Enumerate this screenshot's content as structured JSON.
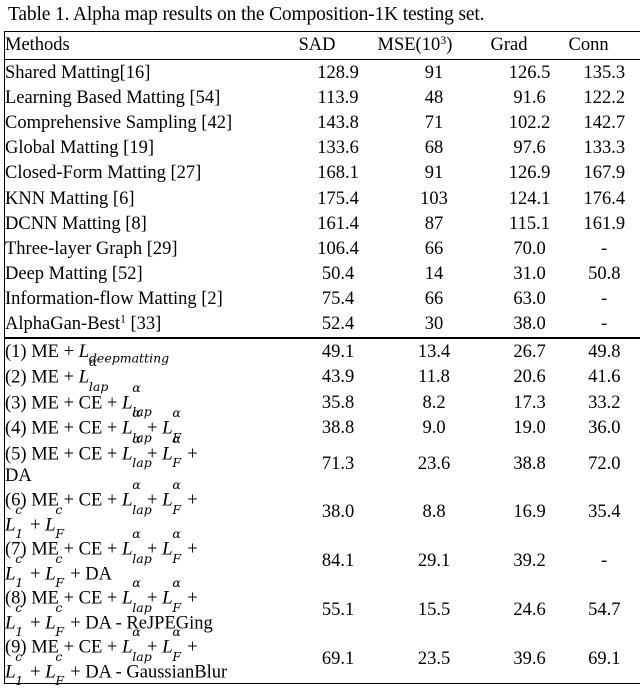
{
  "caption": "Table 1. Alpha map results on the Composition-1K testing set.",
  "table": {
    "columns": [
      "Methods",
      "SAD",
      "MSE(10³)",
      "Grad",
      "Conn"
    ],
    "headers": {
      "methods": "Methods",
      "sad": "SAD",
      "mse": "MSE(10",
      "mse_exp": "3",
      "mse_close": ")",
      "grad": "Grad",
      "conn": "Conn"
    },
    "prior_work": [
      {
        "method": "Shared Matting[16]",
        "sad": "128.9",
        "mse": "91",
        "grad": "126.5",
        "conn": "135.3"
      },
      {
        "method": "Learning Based Matting [54]",
        "sad": "113.9",
        "mse": "48",
        "grad": "91.6",
        "conn": "122.2"
      },
      {
        "method": "Comprehensive Sampling [42]",
        "sad": "143.8",
        "mse": "71",
        "grad": "102.2",
        "conn": "142.7"
      },
      {
        "method": "Global Matting [19]",
        "sad": "133.6",
        "mse": "68",
        "grad": "97.6",
        "conn": "133.3"
      },
      {
        "method": "Closed-Form Matting [27]",
        "sad": "168.1",
        "mse": "91",
        "grad": "126.9",
        "conn": "167.9"
      },
      {
        "method": "KNN Matting [6]",
        "sad": "175.4",
        "mse": "103",
        "grad": "124.1",
        "conn": "176.4"
      },
      {
        "method": "DCNN Matting [8]",
        "sad": "161.4",
        "mse": "87",
        "grad": "115.1",
        "conn": "161.9"
      },
      {
        "method": "Three-layer Graph [29]",
        "sad": "106.4",
        "mse": "66",
        "grad": "70.0",
        "conn": "-"
      },
      {
        "method": "Deep Matting [52]",
        "sad": "50.4",
        "mse": "14",
        "grad": "31.0",
        "conn": "50.8"
      },
      {
        "method": "Information-flow Matting [2]",
        "sad": "75.4",
        "mse": "66",
        "grad": "63.0",
        "conn": "-"
      },
      {
        "method": "AlphaGan-Best",
        "method_footnote": "1",
        "method_tail": " [33]",
        "sad": "52.4",
        "mse": "30",
        "grad": "38.0",
        "conn": "-"
      }
    ],
    "ablations": [
      {
        "index": "(1)",
        "sad": "49.1",
        "mse": "13.4",
        "grad": "26.7",
        "conn": "49.8",
        "sad_bold": false,
        "mse_bold": false,
        "grad_bold": false,
        "conn_bold": false
      },
      {
        "index": "(2)",
        "sad": "43.9",
        "mse": "11.8",
        "grad": "20.6",
        "conn": "41.6",
        "sad_bold": false,
        "mse_bold": false,
        "grad_bold": false,
        "conn_bold": false
      },
      {
        "index": "(3)",
        "sad": "35.8",
        "mse": "8.2",
        "grad": "17.3",
        "conn": "33.2",
        "sad_bold": true,
        "mse_bold": true,
        "grad_bold": false,
        "conn_bold": true
      },
      {
        "index": "(4)",
        "sad": "38.8",
        "mse": "9.0",
        "grad": "19.0",
        "conn": "36.0",
        "sad_bold": false,
        "mse_bold": false,
        "grad_bold": false,
        "conn_bold": false
      },
      {
        "index": "(5)",
        "sad": "71.3",
        "mse": "23.6",
        "grad": "38.8",
        "conn": "72.0",
        "sad_bold": false,
        "mse_bold": false,
        "grad_bold": false,
        "conn_bold": false
      },
      {
        "index": "(6)",
        "sad": "38.0",
        "mse": "8.8",
        "grad": "16.9",
        "conn": "35.4",
        "sad_bold": false,
        "mse_bold": false,
        "grad_bold": true,
        "conn_bold": false
      },
      {
        "index": "(7)",
        "sad": "84.1",
        "mse": "29.1",
        "grad": "39.2",
        "conn": "-",
        "sad_bold": false,
        "mse_bold": false,
        "grad_bold": false,
        "conn_bold": false
      },
      {
        "index": "(8)",
        "sad": "55.1",
        "mse": "15.5",
        "grad": "24.6",
        "conn": "54.7",
        "sad_bold": false,
        "mse_bold": false,
        "grad_bold": false,
        "conn_bold": false
      },
      {
        "index": "(9)",
        "sad": "69.1",
        "mse": "23.5",
        "grad": "39.6",
        "conn": "69.1",
        "sad_bold": false,
        "mse_bold": false,
        "grad_bold": false,
        "conn_bold": false
      }
    ],
    "ablation_terms": {
      "me": "ME",
      "ce": "CE",
      "da": "DA",
      "plus": "+",
      "minus": "-",
      "rejpeging": "ReJPEGing",
      "gaussianblur": "GaussianBlur",
      "loss_symbol": "L",
      "sub_deepmatting": "deepmatting",
      "sub_lap": "lap",
      "sub_F": "F",
      "sub_1": "1",
      "sup_alpha": "α",
      "sup_c": "c"
    },
    "ablation_labels": [
      "(1) ME + L_deepmatting",
      "(2) ME + L^α_lap",
      "(3) ME + CE + L^α_lap",
      "(4) ME + CE + L^α_lap + L^α_F",
      "(5) ME + CE + L^α_lap + L^α_F + DA",
      "(6) ME + CE + L^α_lap + L^α_F + L^c_1 + L^c_F",
      "(7) ME + CE + L^α_lap + L^α_F + L^c_1 + L^c_F + DA",
      "(8) ME + CE + L^α_lap + L^α_F + L^c_1 + L^c_F + DA - ReJPEGing",
      "(9) ME + CE + L^α_lap + L^α_F + L^c_1 + L^c_F + DA - GaussianBlur"
    ]
  },
  "colors": {
    "text": "#000000",
    "background": "#ffffff",
    "rule": "#000000"
  }
}
